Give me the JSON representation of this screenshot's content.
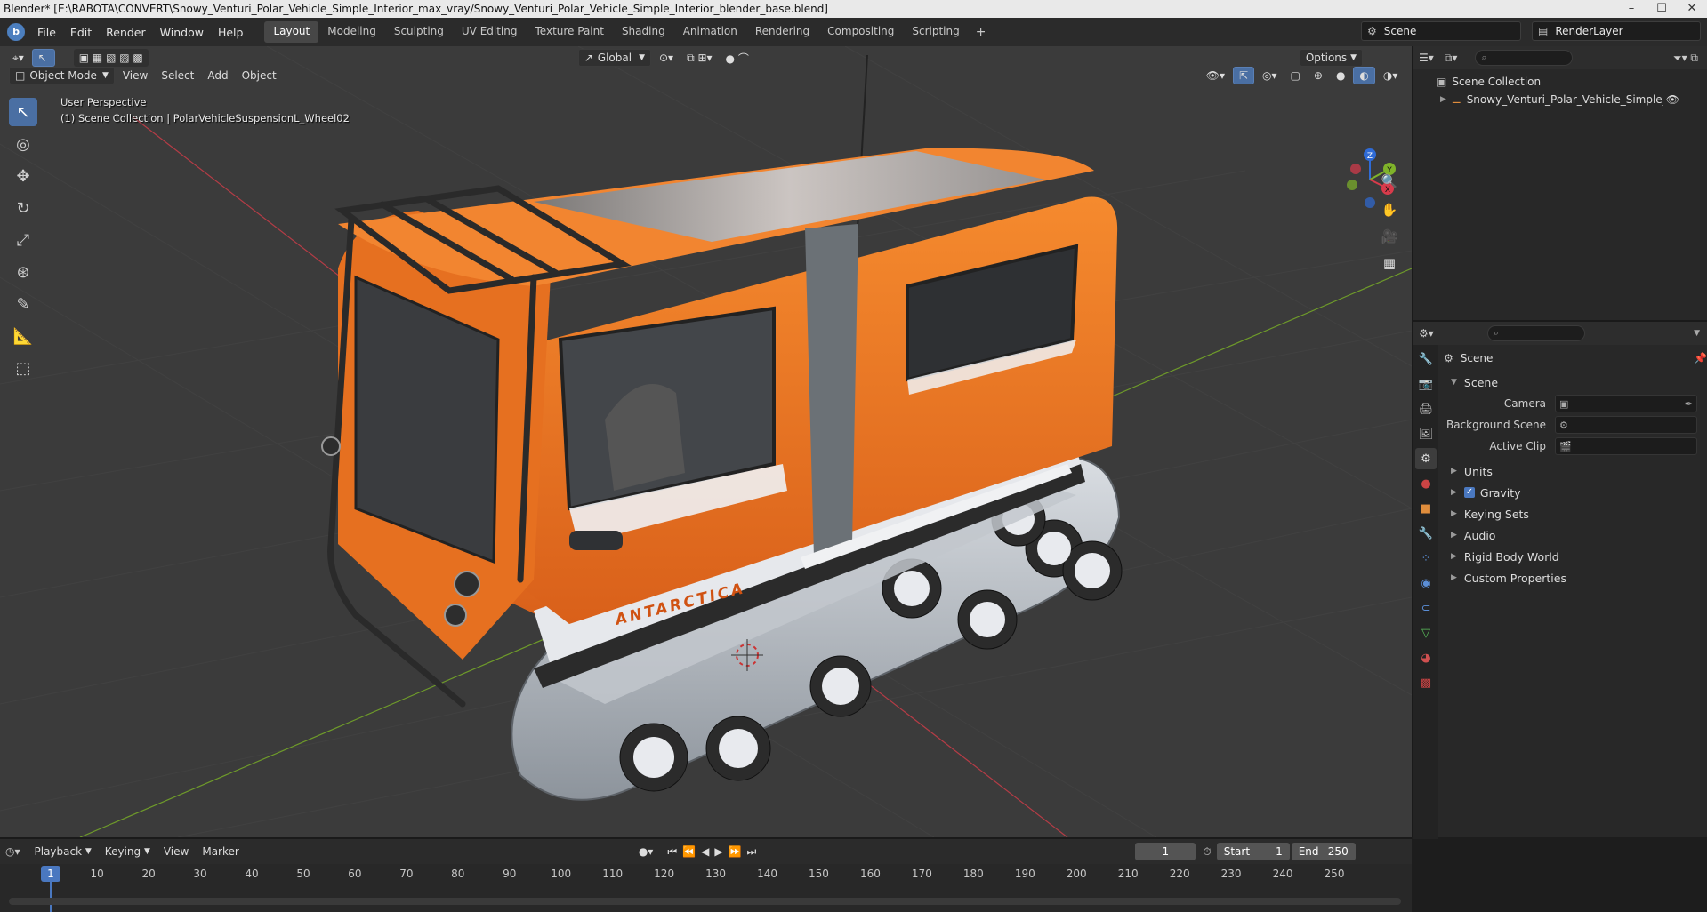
{
  "window": {
    "title": "Blender* [E:\\RABOTA\\CONVERT\\Snowy_Venturi_Polar_Vehicle_Simple_Interior_max_vray/Snowy_Venturi_Polar_Vehicle_Simple_Interior_blender_base.blend]",
    "controls": [
      "–",
      "☐",
      "✕"
    ]
  },
  "menu": [
    "File",
    "Edit",
    "Render",
    "Window",
    "Help"
  ],
  "workspaces": [
    "Layout",
    "Modeling",
    "Sculpting",
    "UV Editing",
    "Texture Paint",
    "Shading",
    "Animation",
    "Rendering",
    "Compositing",
    "Scripting"
  ],
  "active_workspace": "Layout",
  "scene_selector": "Scene",
  "renderlayer_selector": "RenderLayer",
  "viewport": {
    "mode": "Object Mode",
    "menus": [
      "View",
      "Select",
      "Add",
      "Object"
    ],
    "transform_orientation": "Global",
    "options_label": "Options",
    "perspective": "User Perspective",
    "collection_info": "(1) Scene Collection | PolarVehicleSuspensionL_Wheel02",
    "vehicle_decal": "ANTARCTICA",
    "gizmo": {
      "z": "Z",
      "y": "Y",
      "x": "X"
    }
  },
  "outliner": {
    "root": "Scene Collection",
    "items": [
      "Snowy_Venturi_Polar_Vehicle_Simple_Interic"
    ]
  },
  "properties": {
    "header": "Scene",
    "panel": "Scene",
    "fields": [
      {
        "label": "Camera",
        "value": ""
      },
      {
        "label": "Background Scene",
        "value": ""
      },
      {
        "label": "Active Clip",
        "value": ""
      }
    ],
    "subpanels": [
      "Units",
      "Gravity",
      "Keying Sets",
      "Audio",
      "Rigid Body World",
      "Custom Properties"
    ],
    "gravity_checked": true
  },
  "timeline": {
    "menus": [
      "Playback",
      "Keying",
      "View",
      "Marker"
    ],
    "current_frame": "1",
    "start_label": "Start",
    "start": "1",
    "end_label": "End",
    "end": "250",
    "ticks": [
      "1",
      "10",
      "20",
      "30",
      "40",
      "50",
      "60",
      "70",
      "80",
      "90",
      "100",
      "110",
      "120",
      "130",
      "140",
      "150",
      "160",
      "170",
      "180",
      "190",
      "200",
      "210",
      "220",
      "230",
      "240",
      "250"
    ]
  },
  "colors": {
    "accent": "#4a78c0",
    "vehicle_orange": "#f07a1e",
    "snow": "#e6e8ec",
    "grid": "#454545"
  }
}
